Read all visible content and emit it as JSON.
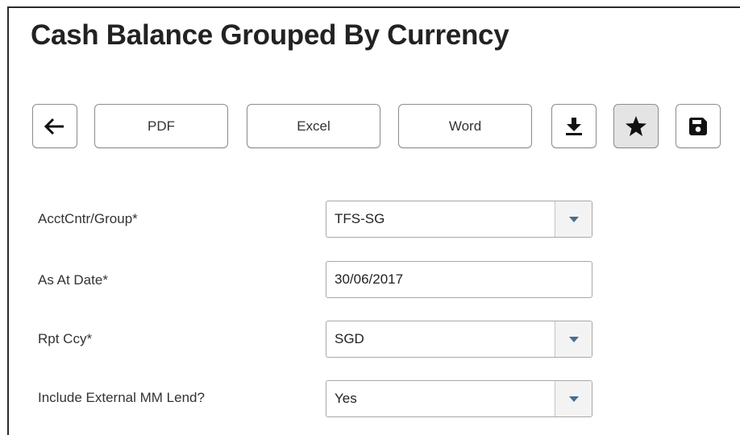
{
  "page": {
    "title": "Cash Balance Grouped By Currency"
  },
  "toolbar": {
    "back_icon": "arrow-left-icon",
    "pdf_label": "PDF",
    "excel_label": "Excel",
    "word_label": "Word",
    "download_icon": "download-icon",
    "favorite_icon": "star-icon",
    "save_icon": "floppy-disk-icon"
  },
  "form": {
    "acct_cntr_group": {
      "label": "AcctCntr/Group*",
      "value": "TFS-SG",
      "type": "select"
    },
    "as_at_date": {
      "label": "As At Date*",
      "value": "30/06/2017",
      "type": "text"
    },
    "rpt_ccy": {
      "label": "Rpt Ccy*",
      "value": "SGD",
      "type": "select"
    },
    "include_external_mm_lend": {
      "label": "Include External MM Lend?",
      "value": "Yes",
      "type": "select"
    }
  },
  "colors": {
    "caret": "#4a6d8c",
    "active_button_bg": "#e4e4e4",
    "border": "#a8a8a8"
  }
}
